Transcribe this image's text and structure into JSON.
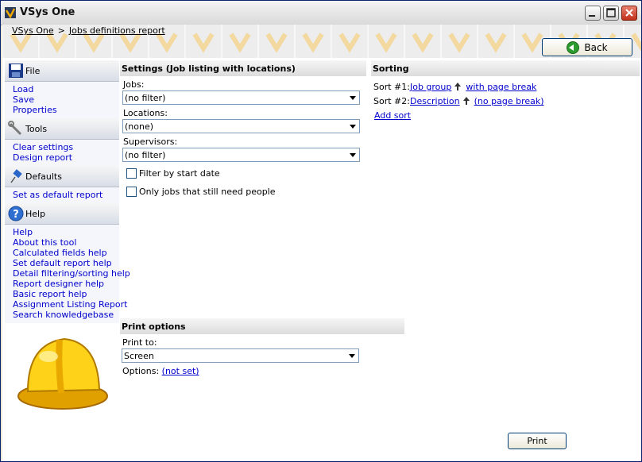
{
  "window": {
    "title": "VSys One"
  },
  "breadcrumb": {
    "root": "VSys One",
    "separator": ">",
    "current": "Jobs definitions report"
  },
  "back_button": {
    "label": "Back"
  },
  "sidebar": {
    "file": {
      "title": "File",
      "items": [
        "Load",
        "Save",
        "Properties"
      ]
    },
    "tools": {
      "title": "Tools",
      "items": [
        "Clear settings",
        "Design report"
      ]
    },
    "defaults": {
      "title": "Defaults",
      "items": [
        "Set as default report"
      ]
    },
    "help": {
      "title": "Help",
      "items": [
        "Help",
        "About this tool",
        "Calculated fields help",
        "Set default report help",
        "Detail filtering/sorting help",
        "Report designer help",
        "Basic report help",
        "Assignment Listing Report",
        "Search knowledgebase"
      ]
    }
  },
  "settings": {
    "header": "Settings (Job listing with locations)",
    "jobs_label": "Jobs:",
    "jobs_value": "(no filter)",
    "locations_label": "Locations:",
    "locations_value": "(none)",
    "supervisors_label": "Supervisors:",
    "supervisors_value": "(no filter)",
    "filter_start_date_label": "Filter by start date",
    "need_people_label": "Only jobs that still need people"
  },
  "sorting": {
    "header": "Sorting",
    "sorts": [
      {
        "label": "Sort #1:",
        "field": "Job group",
        "break": "with page break"
      },
      {
        "label": "Sort #2:",
        "field": "Description",
        "break": "(no page break)"
      }
    ],
    "add_sort": "Add sort"
  },
  "print_options": {
    "header": "Print options",
    "print_to_label": "Print to:",
    "print_to_value": "Screen",
    "options_label": "Options:",
    "options_value": "(not set)"
  },
  "print_button": {
    "label": "Print"
  },
  "colors": {
    "link": "#0000cc",
    "title_close": "#c0301a",
    "accent_orange": "#f0a800"
  }
}
